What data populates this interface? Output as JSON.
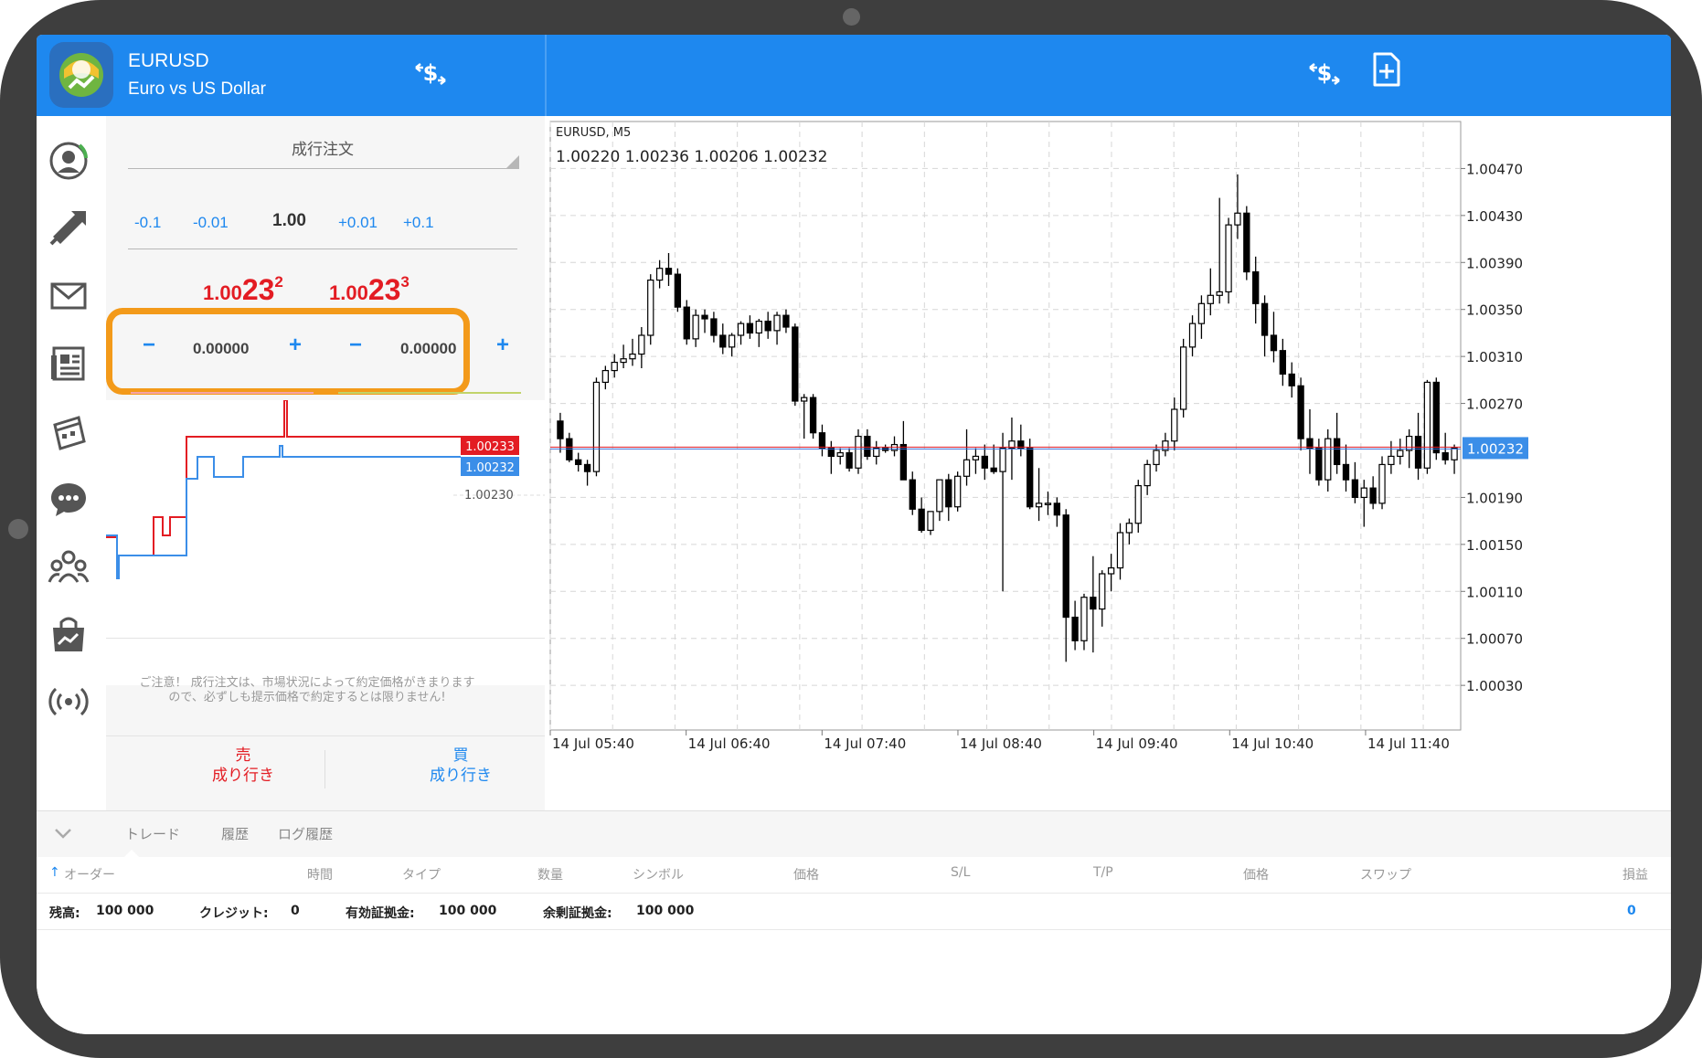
{
  "header": {
    "symbol": "EURUSD",
    "description": "Euro vs US Dollar"
  },
  "order_panel": {
    "order_type": "成行注文",
    "volume_steps": [
      "-0.1",
      "-0.01",
      "+0.01",
      "+0.1"
    ],
    "volume": "1.00",
    "bid": {
      "small": "1.00",
      "big": "23",
      "sup": "2"
    },
    "ask": {
      "small": "1.00",
      "big": "23",
      "sup": "3"
    },
    "stop_loss": "0.00000",
    "take_profit": "0.00000",
    "tick_chart": {
      "ask_label": "1.00233",
      "bid_label": "1.00232",
      "level_label": "1.00230",
      "ask_color": "#e31c23",
      "bid_color": "#3b8ee8"
    },
    "notice_line1": "ご注意！ 成行注文は、市場状況によって約定価格がきまります",
    "notice_line2": "ので、必ずしも提示価格で約定するとは限りません!",
    "sell_label": "売",
    "sell_sub": "成り行き",
    "buy_label": "買",
    "buy_sub": "成り行き"
  },
  "chart_data": {
    "type": "candlestick",
    "title": "EURUSD, M5",
    "ohlc_readout": "1.00220 1.00236 1.00206 1.00232",
    "ylim": [
      0.99992,
      1.0051
    ],
    "y_ticks": [
      "1.00470",
      "1.00430",
      "1.00390",
      "1.00350",
      "1.00310",
      "1.00270",
      "1.00190",
      "1.00150",
      "1.00110",
      "1.00070",
      "1.00030"
    ],
    "y_tick_values": [
      1.0047,
      1.0043,
      1.0039,
      1.0035,
      1.0031,
      1.0027,
      1.0019,
      1.0015,
      1.0011,
      1.0007,
      1.0003
    ],
    "x_ticks": [
      "14 Jul 05:40",
      "14 Jul 06:40",
      "14 Jul 07:40",
      "14 Jul 08:40",
      "14 Jul 09:40",
      "14 Jul 10:40",
      "14 Jul 11:40"
    ],
    "current_price": "1.00232",
    "current_price_value": 1.00232,
    "candles": [
      [
        1.00255,
        1.00262,
        1.00228,
        1.0024
      ],
      [
        1.0024,
        1.00245,
        1.0022,
        1.00222
      ],
      [
        1.00222,
        1.00228,
        1.00212,
        1.00218
      ],
      [
        1.00218,
        1.00222,
        1.002,
        1.00212
      ],
      [
        1.00212,
        1.00292,
        1.00208,
        1.00288
      ],
      [
        1.00288,
        1.00302,
        1.00282,
        1.00298
      ],
      [
        1.00298,
        1.00312,
        1.00292,
        1.00305
      ],
      [
        1.00305,
        1.0032,
        1.003,
        1.00308
      ],
      [
        1.00308,
        1.00325,
        1.00302,
        1.00312
      ],
      [
        1.00312,
        1.00335,
        1.003,
        1.00328
      ],
      [
        1.00328,
        1.0038,
        1.0032,
        1.00375
      ],
      [
        1.00375,
        1.00392,
        1.00368,
        1.00385
      ],
      [
        1.00385,
        1.00398,
        1.0037,
        1.0038
      ],
      [
        1.0038,
        1.00385,
        1.00348,
        1.00352
      ],
      [
        1.00352,
        1.00358,
        1.0032,
        1.00325
      ],
      [
        1.00325,
        1.0035,
        1.00318,
        1.00345
      ],
      [
        1.00345,
        1.0035,
        1.0033,
        1.00342
      ],
      [
        1.00342,
        1.00348,
        1.00322,
        1.00328
      ],
      [
        1.00328,
        1.00338,
        1.00312,
        1.00318
      ],
      [
        1.00318,
        1.0033,
        1.0031,
        1.00328
      ],
      [
        1.00328,
        1.0034,
        1.0032,
        1.00338
      ],
      [
        1.00338,
        1.00345,
        1.00325,
        1.0033
      ],
      [
        1.0033,
        1.00342,
        1.00318,
        1.0034
      ],
      [
        1.0034,
        1.00348,
        1.00325,
        1.00332
      ],
      [
        1.00332,
        1.00348,
        1.0032,
        1.00345
      ],
      [
        1.00345,
        1.0035,
        1.0033,
        1.00335
      ],
      [
        1.00335,
        1.00338,
        1.00268,
        1.00272
      ],
      [
        1.00272,
        1.00278,
        1.0024,
        1.00275
      ],
      [
        1.00275,
        1.00278,
        1.0024,
        1.00245
      ],
      [
        1.00245,
        1.00252,
        1.00225,
        1.00232
      ],
      [
        1.00232,
        1.00238,
        1.0021,
        1.00225
      ],
      [
        1.00225,
        1.00232,
        1.00218,
        1.00228
      ],
      [
        1.00228,
        1.00232,
        1.00212,
        1.00215
      ],
      [
        1.00215,
        1.00248,
        1.0021,
        1.00242
      ],
      [
        1.00242,
        1.00248,
        1.00222,
        1.00225
      ],
      [
        1.00225,
        1.00238,
        1.00218,
        1.00232
      ],
      [
        1.00232,
        1.00235,
        1.00228,
        1.0023
      ],
      [
        1.0023,
        1.00242,
        1.00225,
        1.00235
      ],
      [
        1.00235,
        1.00255,
        1.00205,
        1.00205
      ],
      [
        1.00205,
        1.00212,
        1.00175,
        1.0018
      ],
      [
        1.0018,
        1.0019,
        1.0016,
        1.00162
      ],
      [
        1.00162,
        1.00178,
        1.00158,
        1.00178
      ],
      [
        1.00178,
        1.00205,
        1.0017,
        1.00205
      ],
      [
        1.00205,
        1.0021,
        1.0017,
        1.00182
      ],
      [
        1.00182,
        1.00212,
        1.00178,
        1.00208
      ],
      [
        1.00208,
        1.00248,
        1.002,
        1.00222
      ],
      [
        1.00222,
        1.00232,
        1.0021,
        1.00225
      ],
      [
        1.00225,
        1.00235,
        1.00205,
        1.00215
      ],
      [
        1.00215,
        1.00235,
        1.0021,
        1.00212
      ],
      [
        1.00212,
        1.00245,
        1.0011,
        1.00232
      ],
      [
        1.00232,
        1.00258,
        1.00205,
        1.00238
      ],
      [
        1.00238,
        1.00252,
        1.00225,
        1.00232
      ],
      [
        1.00232,
        1.0024,
        1.0018,
        1.00182
      ],
      [
        1.00182,
        1.00215,
        1.0017,
        1.00185
      ],
      [
        1.00185,
        1.00195,
        1.00175,
        1.00185
      ],
      [
        1.00185,
        1.0019,
        1.00165,
        1.00175
      ],
      [
        1.00175,
        1.0018,
        1.0005,
        1.00088
      ],
      [
        1.00088,
        1.00102,
        1.0006,
        1.00068
      ],
      [
        1.00068,
        1.00108,
        1.0006,
        1.00105
      ],
      [
        1.00105,
        1.0014,
        1.00058,
        1.00095
      ],
      [
        1.00095,
        1.00128,
        1.0008,
        1.00125
      ],
      [
        1.00125,
        1.00142,
        1.0011,
        1.0013
      ],
      [
        1.0013,
        1.00168,
        1.0012,
        1.0016
      ],
      [
        1.0016,
        1.00172,
        1.0015,
        1.00168
      ],
      [
        1.00168,
        1.00205,
        1.0016,
        1.002
      ],
      [
        1.002,
        1.00222,
        1.00192,
        1.00218
      ],
      [
        1.00218,
        1.00235,
        1.00212,
        1.0023
      ],
      [
        1.0023,
        1.00245,
        1.00225,
        1.00238
      ],
      [
        1.00238,
        1.00275,
        1.0023,
        1.00265
      ],
      [
        1.00265,
        1.00325,
        1.00258,
        1.00318
      ],
      [
        1.00318,
        1.00345,
        1.0031,
        1.00338
      ],
      [
        1.00338,
        1.00362,
        1.00325,
        1.00355
      ],
      [
        1.00355,
        1.00385,
        1.00345,
        1.00362
      ],
      [
        1.00362,
        1.00445,
        1.00355,
        1.00365
      ],
      [
        1.00365,
        1.00428,
        1.00355,
        1.00422
      ],
      [
        1.00422,
        1.00465,
        1.0041,
        1.00432
      ],
      [
        1.00432,
        1.00438,
        1.00375,
        1.00382
      ],
      [
        1.00382,
        1.00395,
        1.00338,
        1.00355
      ],
      [
        1.00355,
        1.00362,
        1.0031,
        1.00328
      ],
      [
        1.00328,
        1.00348,
        1.00305,
        1.00315
      ],
      [
        1.00315,
        1.00325,
        1.00285,
        1.00295
      ],
      [
        1.00295,
        1.00305,
        1.00275,
        1.00285
      ],
      [
        1.00285,
        1.00292,
        1.0023,
        1.0024
      ],
      [
        1.0024,
        1.00265,
        1.0021,
        1.00232
      ],
      [
        1.00232,
        1.0024,
        1.002,
        1.00205
      ],
      [
        1.00205,
        1.00248,
        1.00195,
        1.0024
      ],
      [
        1.0024,
        1.00262,
        1.0021,
        1.00218
      ],
      [
        1.00218,
        1.00235,
        1.00195,
        1.00205
      ],
      [
        1.00205,
        1.0022,
        1.00185,
        1.0019
      ],
      [
        1.0019,
        1.00205,
        1.00165,
        1.00198
      ],
      [
        1.00198,
        1.00208,
        1.0018,
        1.00185
      ],
      [
        1.00185,
        1.00225,
        1.0018,
        1.00218
      ],
      [
        1.00218,
        1.00238,
        1.0021,
        1.00225
      ],
      [
        1.00225,
        1.0024,
        1.00218,
        1.0023
      ],
      [
        1.0023,
        1.00248,
        1.00215,
        1.00242
      ],
      [
        1.00242,
        1.00262,
        1.00205,
        1.00215
      ],
      [
        1.00215,
        1.0029,
        1.0021,
        1.00288
      ],
      [
        1.00288,
        1.00292,
        1.00222,
        1.00228
      ],
      [
        1.00228,
        1.00245,
        1.00218,
        1.00222
      ],
      [
        1.00222,
        1.00235,
        1.0021,
        1.00232
      ]
    ]
  },
  "terminal": {
    "tabs": [
      "トレード",
      "履歴",
      "ログ履歴"
    ],
    "columns": [
      "オーダー",
      "時間",
      "タイプ",
      "数量",
      "シンボル",
      "価格",
      "S/L",
      "T/P",
      "価格",
      "スワップ",
      "損益"
    ],
    "balance_label": "残高:",
    "balance_value": "100 000",
    "credit_label": "クレジット:",
    "credit_value": "0",
    "equity_label": "有効証拠金:",
    "equity_value": "100 000",
    "free_margin_label": "余剰証拠金:",
    "free_margin_value": "100 000",
    "profit_total": "0"
  },
  "colors": {
    "brand": "#1e88ef",
    "sell": "#e31c23",
    "highlight": "#f39a1a"
  }
}
